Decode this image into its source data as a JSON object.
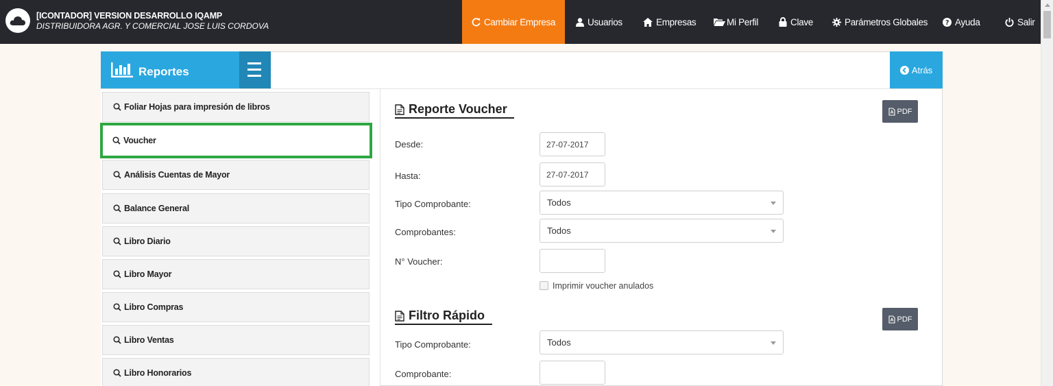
{
  "topbar": {
    "title": "[ICONTADOR] VERSION DESARROLLO IQAMP",
    "subtitle": "DISTRIBUIDORA AGR. Y COMERCIAL JOSE LUIS CORDOVA",
    "nav": {
      "cambiar_empresa": "Cambiar Empresa",
      "usuarios": "Usuarios",
      "empresas": "Empresas",
      "mi_perfil": "Mi Perfil",
      "clave": "Clave",
      "parametros": "Parámetros Globales",
      "ayuda": "Ayuda",
      "salir": "Salir"
    },
    "accent": "#f47b12"
  },
  "panel": {
    "title": "Reportes",
    "back": "Atrás",
    "accent": "#2aa7df"
  },
  "sidebar": {
    "items": [
      {
        "label": "Foliar Hojas para impresión de libros"
      },
      {
        "label": "Voucher",
        "selected": true
      },
      {
        "label": "Análisis Cuentas de Mayor"
      },
      {
        "label": "Balance General"
      },
      {
        "label": "Libro Diario"
      },
      {
        "label": "Libro Mayor"
      },
      {
        "label": "Libro Compras"
      },
      {
        "label": "Libro Ventas"
      },
      {
        "label": "Libro Honorarios"
      }
    ],
    "selected_border": "#2ea742"
  },
  "voucher": {
    "title": "Reporte Voucher",
    "pdf": "PDF",
    "desde_label": "Desde:",
    "desde_value": "27-07-2017",
    "hasta_label": "Hasta:",
    "hasta_value": "27-07-2017",
    "tipo_label": "Tipo Comprobante:",
    "tipo_value": "Todos",
    "comprobantes_label": "Comprobantes:",
    "comprobantes_value": "Todos",
    "numero_label": "N° Voucher:",
    "numero_value": "",
    "anulados_label": "Imprimir voucher anulados"
  },
  "filtro": {
    "title": "Filtro Rápido",
    "pdf": "PDF",
    "tipo_label": "Tipo Comprobante:",
    "tipo_value": "Todos",
    "comprobante_label": "Comprobante:",
    "comprobante_value": ""
  }
}
